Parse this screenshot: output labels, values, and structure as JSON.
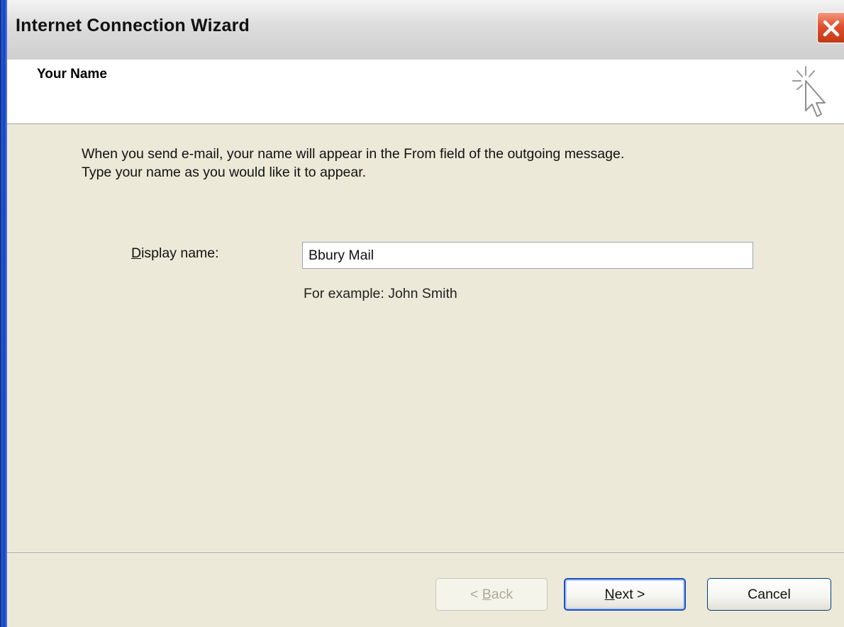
{
  "window": {
    "title": "Internet Connection Wizard"
  },
  "header": {
    "title": "Your Name",
    "icon": "wizard-cursor-icon"
  },
  "intro": {
    "line1": "When you send e-mail, your name will appear in the From field of the outgoing message.",
    "line2": "Type your name as you would like it to appear."
  },
  "form": {
    "display_name_label_mnemonic": "D",
    "display_name_label_rest": "isplay name:",
    "display_name_value": "Bbury Mail",
    "example_text": "For example: John Smith"
  },
  "buttons": {
    "back_prefix": "< ",
    "back_mnemonic": "B",
    "back_rest": "ack",
    "next_mnemonic": "N",
    "next_rest": "ext >",
    "cancel": "Cancel"
  },
  "colors": {
    "dialog_bg": "#ECE9D8",
    "header_bg": "#FFFFFF",
    "close_button": "#E0502D",
    "default_button_border": "#1D4EC0"
  }
}
